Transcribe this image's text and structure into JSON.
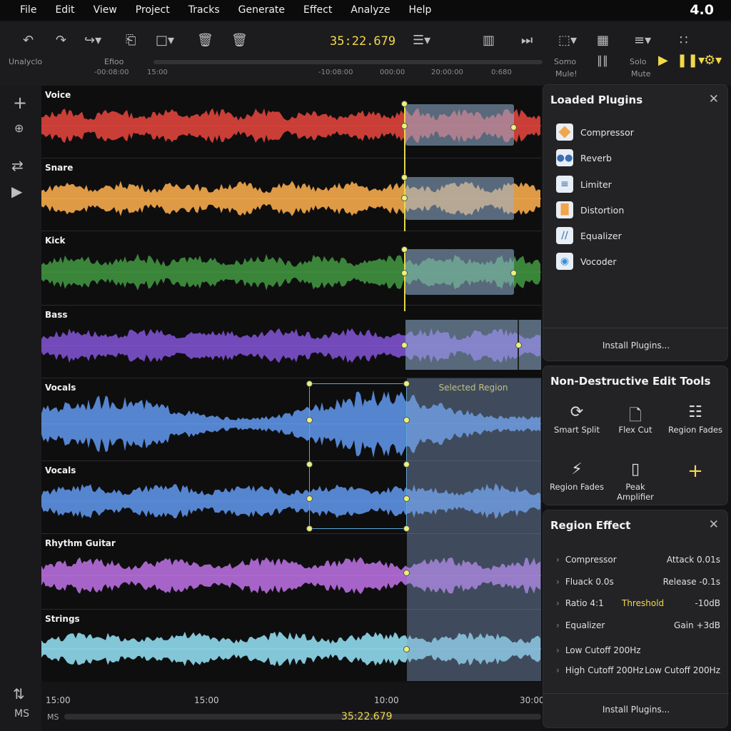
{
  "menu": [
    "File",
    "Edit",
    "View",
    "Project",
    "Tracks",
    "Generate",
    "Effect",
    "Analyze",
    "Help"
  ],
  "version": "4.0",
  "toolbar": {
    "clock": "35:22.679",
    "label_left1": "Unalyclo",
    "label_left2": "Efioo",
    "label_somo": "Somo",
    "label_mulet": "Mule!",
    "label_solo": "Solo",
    "label_mute": "Mute"
  },
  "ruler": [
    "-00:08:00",
    "15:00",
    "-10:08:00",
    "000:00",
    "20:00:00",
    "0:680"
  ],
  "tracks": [
    {
      "name": "Voice",
      "color": "#d9423a"
    },
    {
      "name": "Snare",
      "color": "#f0a64a"
    },
    {
      "name": "Kick",
      "color": "#3f8f3f"
    },
    {
      "name": "Bass",
      "color": "#7b4fc9"
    },
    {
      "name": "Vocals",
      "color": "#5b8fe0"
    },
    {
      "name": "Vocals",
      "color": "#5b8fe0"
    },
    {
      "name": "Rhythm Guitar",
      "color": "#b36bd8"
    },
    {
      "name": "Strings",
      "color": "#8cd6e8"
    }
  ],
  "selected_region_label": "Selected Region",
  "bottom": {
    "ticks": [
      "15:00",
      "15:00",
      "10:00",
      "30:00"
    ],
    "left_label": "MS",
    "clock": "35:22.679",
    "leftbar_label": "MS"
  },
  "loaded_plugins": {
    "title": "Loaded Plugins",
    "items": [
      {
        "label": "Compressor",
        "icon": "compressor-icon",
        "color": "#f0a64a"
      },
      {
        "label": "Reverb",
        "icon": "reverb-icon",
        "color": "#3b6fb5"
      },
      {
        "label": "Limiter",
        "icon": "limiter-icon",
        "color": "#3b6fb5"
      },
      {
        "label": "Distortion",
        "icon": "distortion-icon",
        "color": "#f0a64a"
      },
      {
        "label": "Equalizer",
        "icon": "equalizer-icon",
        "color": "#3b6fb5"
      },
      {
        "label": "Vocoder",
        "icon": "vocoder-icon",
        "color": "#3b8fd9"
      }
    ],
    "install": "Install Plugins..."
  },
  "edit_tools": {
    "title": "Non-Destructive Edit Tools",
    "items": [
      {
        "label": "Smart Split",
        "icon": "smart-split-icon"
      },
      {
        "label": "Flex Cut",
        "icon": "flex-cut-icon"
      },
      {
        "label": "Region Fades",
        "icon": "region-fades-icon"
      },
      {
        "label": "Region Fades",
        "icon": "region-fades-alt-icon"
      },
      {
        "label": "Peak Amplifier",
        "icon": "peak-amplifier-icon"
      },
      {
        "label": "",
        "icon": "add-icon"
      }
    ]
  },
  "region_effect": {
    "title": "Region Effect",
    "rows": [
      {
        "left": "Compressor",
        "mid": "",
        "right": "Attack 0.01s"
      },
      {
        "left": "Fluack 0.0s",
        "mid": "",
        "right": "Release -0.1s"
      },
      {
        "left": "Ratio 4:1",
        "mid": "Threshold",
        "right": "-10dB"
      },
      {
        "left": "Equalizer",
        "mid": "",
        "right": "Gain +3dB"
      },
      {
        "left": "Low Cutoff 200Hz",
        "mid": "",
        "right": ""
      },
      {
        "left": "High Cutoff 200Hz",
        "mid": "",
        "right": "Low Cutoff 200Hz"
      }
    ],
    "install": "Install Plugins..."
  }
}
